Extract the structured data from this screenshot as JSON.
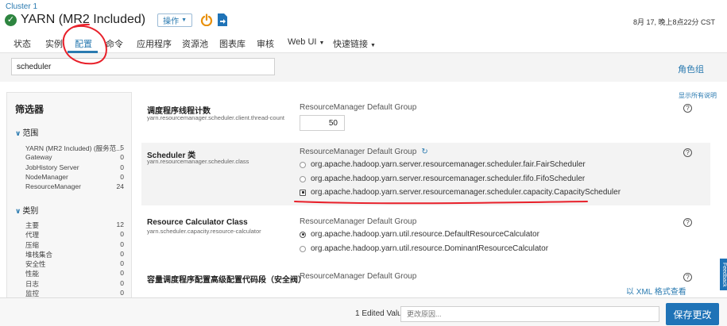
{
  "header": {
    "cluster": "Cluster 1",
    "service_title": "YARN (MR2 Included)",
    "actions_label": "操作",
    "datetime": "8月 17, 晚上8点22分 CST"
  },
  "tabs": [
    {
      "label": "状态"
    },
    {
      "label": "实例"
    },
    {
      "label": "配置"
    },
    {
      "label": "命令"
    },
    {
      "label": "应用程序"
    },
    {
      "label": "资源池"
    },
    {
      "label": "图表库"
    },
    {
      "label": "审核"
    },
    {
      "label": "Web UI"
    },
    {
      "label": "快速链接"
    }
  ],
  "search": {
    "value": "scheduler"
  },
  "role_groups_link": "角色组",
  "show_all_desc": "显示所有说明",
  "filters": {
    "title": "筛选器",
    "scope": {
      "label": "范围",
      "items": [
        {
          "name": "YARN (MR2 Included) (服务范...",
          "count": "5"
        },
        {
          "name": "Gateway",
          "count": "0"
        },
        {
          "name": "JobHistory Server",
          "count": "0"
        },
        {
          "name": "NodeManager",
          "count": "0"
        },
        {
          "name": "ResourceManager",
          "count": "24"
        }
      ]
    },
    "category": {
      "label": "类别",
      "items": [
        {
          "name": "主要",
          "count": "12"
        },
        {
          "name": "代理",
          "count": "0"
        },
        {
          "name": "压缩",
          "count": "0"
        },
        {
          "name": "堆栈集合",
          "count": "0"
        },
        {
          "name": "安全性",
          "count": "0"
        },
        {
          "name": "性能",
          "count": "0"
        },
        {
          "name": "日志",
          "count": "0"
        },
        {
          "name": "监控",
          "count": "0"
        }
      ]
    }
  },
  "configs": [
    {
      "name": "调度程序线程计数",
      "key": "yarn.resourcemanager.scheduler.client.thread-count",
      "group": "ResourceManager Default Group",
      "value": "50"
    },
    {
      "name": "Scheduler 类",
      "key": "yarn.resourcemanager.scheduler.class",
      "group": "ResourceManager Default Group",
      "options": [
        "org.apache.hadoop.yarn.server.resourcemanager.scheduler.fair.FairScheduler",
        "org.apache.hadoop.yarn.server.resourcemanager.scheduler.fifo.FifoScheduler",
        "org.apache.hadoop.yarn.server.resourcemanager.scheduler.capacity.CapacityScheduler"
      ],
      "selected": 2
    },
    {
      "name": "Resource Calculator Class",
      "key": "yarn.scheduler.capacity.resource-calculator",
      "group": "ResourceManager Default Group",
      "options": [
        "org.apache.hadoop.yarn.util.resource.DefaultResourceCalculator",
        "org.apache.hadoop.yarn.util.resource.DominantResourceCalculator"
      ],
      "selected": 0
    },
    {
      "name": "容量调度程序配置高级配置代码段（安全阀）",
      "group": "ResourceManager Default Group"
    }
  ],
  "xml_view_link": "以 XML 格式查看",
  "footer": {
    "edited_count": "1 Edited Value",
    "reason_placeholder": "更改原因...",
    "save_label": "保存更改"
  },
  "feedback_label": "Feedback",
  "colors": {
    "link": "#2a7ab0",
    "primary": "#1f73b7",
    "success": "#2e8540",
    "power": "#e8900a",
    "annotation": "#e8202a"
  }
}
